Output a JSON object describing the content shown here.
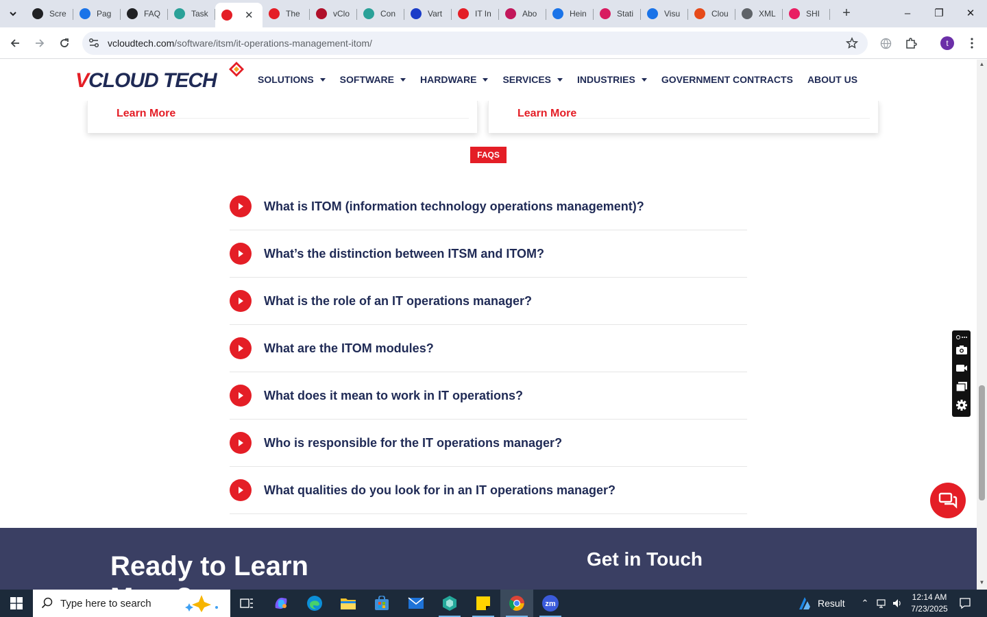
{
  "browser": {
    "tabs": [
      {
        "label": "Scre",
        "favicon": "screenshot-app-icon",
        "color": "#202124"
      },
      {
        "label": "Pag",
        "favicon": "pagespeed-icon",
        "color": "#1a73e8"
      },
      {
        "label": "FAQ",
        "favicon": "openai-icon",
        "color": "#202124"
      },
      {
        "label": "Task",
        "favicon": "task-hexagon-icon",
        "color": "#2aa198"
      },
      {
        "label": "",
        "favicon": "vcloud-diamond-icon",
        "color": "#e41e26"
      },
      {
        "label": "The",
        "favicon": "vcloud-diamond-icon",
        "color": "#e41e26"
      },
      {
        "label": "vClo",
        "favicon": "vcloud-v-icon",
        "color": "#b0102a"
      },
      {
        "label": "Con",
        "favicon": "hexagon-icon",
        "color": "#2aa198"
      },
      {
        "label": "Vart",
        "favicon": "x-logo-icon",
        "color": "#1a3cc8"
      },
      {
        "label": "IT In",
        "favicon": "vcloud-diamond-icon",
        "color": "#e41e26"
      },
      {
        "label": "Abo",
        "favicon": "vcloud-diamond-icon",
        "color": "#c2185b"
      },
      {
        "label": "Hein",
        "favicon": "scale-icon",
        "color": "#1a73e8"
      },
      {
        "label": "Stati",
        "favicon": "pen-icon",
        "color": "#d81b60"
      },
      {
        "label": "Visu",
        "favicon": "pulse-icon",
        "color": "#1a73e8"
      },
      {
        "label": "Clou",
        "favicon": "slash-logo-icon",
        "color": "#e64a19"
      },
      {
        "label": "XML",
        "favicon": "globe-icon",
        "color": "#5f6368"
      },
      {
        "label": "SHI",
        "favicon": "ring-icon",
        "color": "#e91e63"
      }
    ],
    "url_domain": "vcloudtech.com",
    "url_path": "/software/itsm/it-operations-management-itom/",
    "profile_initial": "t"
  },
  "site": {
    "logo_v": "V",
    "logo_rest": "CLOUD TECH",
    "nav": [
      {
        "label": "SOLUTIONS",
        "dropdown": true
      },
      {
        "label": "SOFTWARE",
        "dropdown": true
      },
      {
        "label": "HARDWARE",
        "dropdown": true
      },
      {
        "label": "SERVICES",
        "dropdown": true
      },
      {
        "label": "INDUSTRIES",
        "dropdown": true
      },
      {
        "label": "GOVERNMENT CONTRACTS",
        "dropdown": false
      },
      {
        "label": "ABOUT US",
        "dropdown": false
      }
    ],
    "cards": [
      {
        "link": "Learn More"
      },
      {
        "link": "Learn More"
      }
    ],
    "faq_badge": "FAQS",
    "faqs": [
      "What is ITOM (information technology operations management)?",
      "What’s the distinction between ITSM and ITOM?",
      "What is the role of an IT operations manager?",
      "What are the ITOM modules?",
      "What does it mean to work in IT operations?",
      "Who is responsible for the IT operations manager?",
      "What qualities do you look for in an IT operations manager?"
    ],
    "footer": {
      "ready_line1": "Ready to Learn",
      "ready_line2": "More?",
      "get_in_touch": "Get in Touch"
    },
    "colors": {
      "accent": "#e41e26",
      "navy": "#1f2a55",
      "footer_bg": "#3a3f63"
    }
  },
  "taskbar": {
    "search_placeholder": "Type here to search",
    "tray_label": "Result",
    "time": "12:14 AM",
    "date": "7/23/2025"
  }
}
